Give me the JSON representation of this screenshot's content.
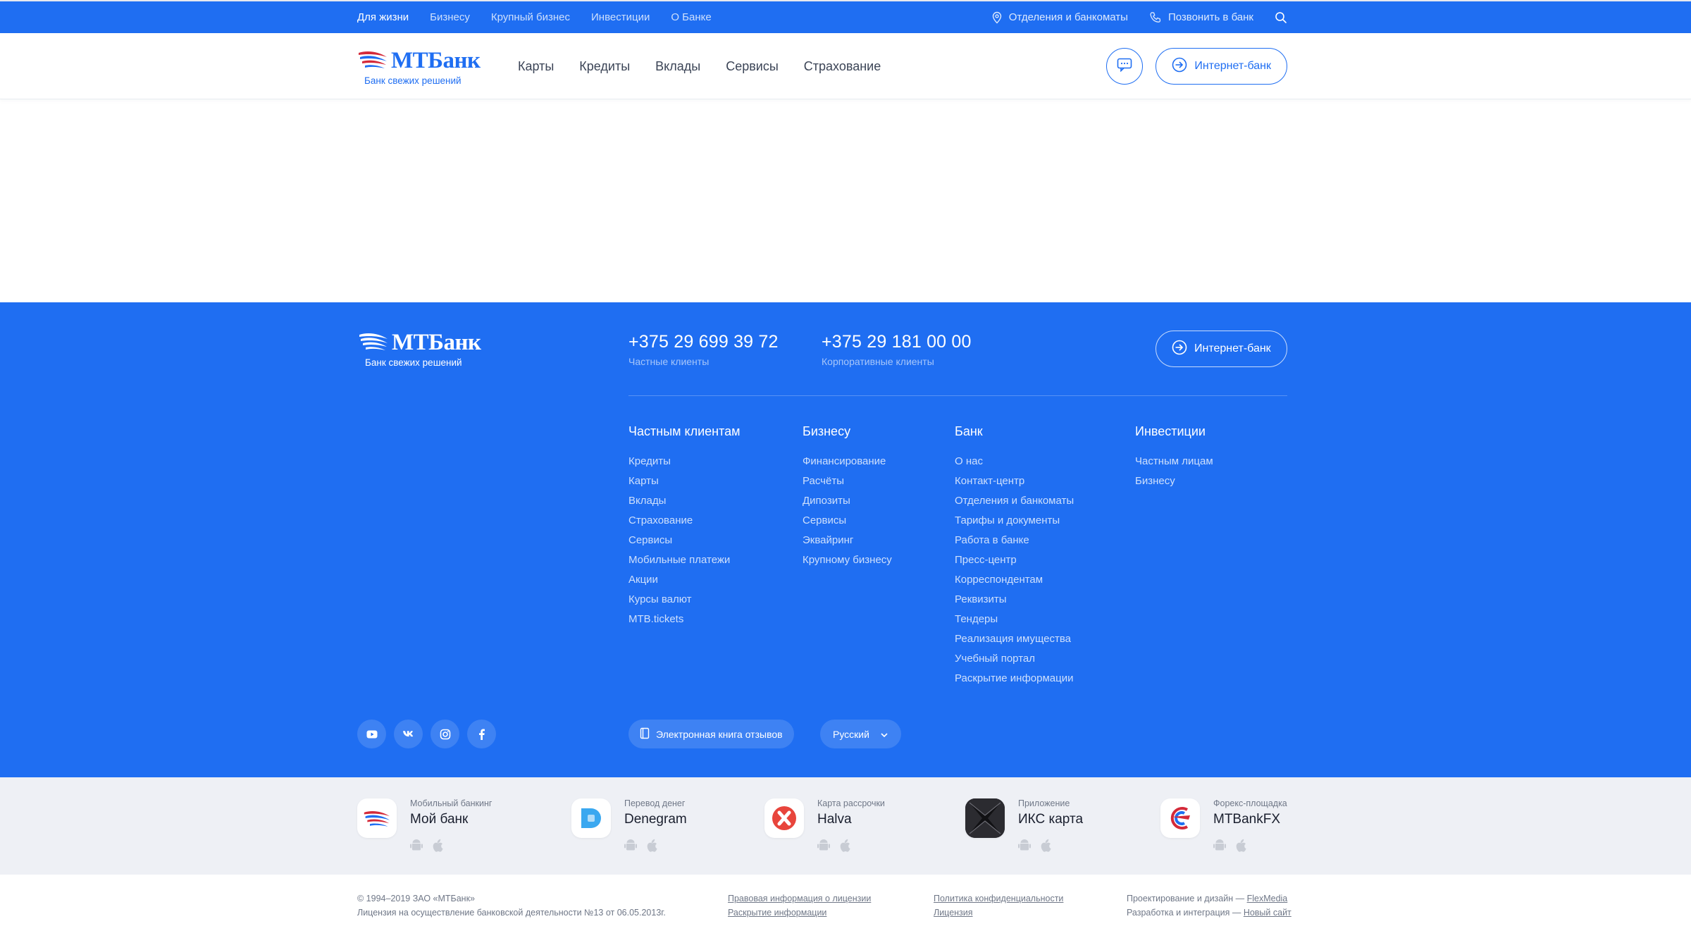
{
  "topbar": {
    "nav": [
      "Для жизни",
      "Бизнесу",
      "Крупный бизнес",
      "Инвестиции",
      "О Банке"
    ],
    "branches": "Отделения и банкоматы",
    "call": "Позвонить в банк"
  },
  "brand": {
    "name": "МТБанк",
    "tagline": "Банк свежих решений"
  },
  "header": {
    "nav": [
      "Карты",
      "Кредиты",
      "Вклады",
      "Сервисы",
      "Страхование"
    ],
    "internet_bank": "Интернет-банк"
  },
  "footer": {
    "phones": [
      {
        "number": "+375 29 699 39 72",
        "label": "Частные клиенты"
      },
      {
        "number": "+375 29 181 00 00",
        "label": "Корпоративные клиенты"
      }
    ],
    "internet_bank": "Интернет-банк",
    "columns": [
      {
        "title": "Частным клиентам",
        "items": [
          "Кредиты",
          "Карты",
          "Вклады",
          "Страхование",
          "Сервисы",
          "Мобильные платежи",
          "Акции",
          "Курсы валют",
          "MTB.tickets"
        ]
      },
      {
        "title": "Бизнесу",
        "items": [
          "Финансирование",
          "Расчёты",
          "Дипозиты",
          "Сервисы",
          "Эквайринг",
          "Крупному бизнесу"
        ]
      },
      {
        "title": "Банк",
        "items": [
          "О нас",
          "Контакт-центр",
          "Отделения и банкоматы",
          "Тарифы и документы",
          "Работа в банке",
          "Пресс-центр",
          "Корреспондентам",
          "Реквизиты",
          "Тендеры",
          "Реализация имущества",
          "Учебный портал",
          "Раскрытие информации"
        ]
      },
      {
        "title": "Инвестиции",
        "items": [
          "Частным лицам",
          "Бизнесу"
        ]
      }
    ],
    "socials": [
      "youtube-icon",
      "vk-icon",
      "instagram-icon",
      "facebook-icon"
    ],
    "review_book": "Электронная книга отзывов",
    "language": "Русский"
  },
  "apps": [
    {
      "caption": "Мобильный банкинг",
      "name": "Мой банк"
    },
    {
      "caption": "Перевод денег",
      "name": "Denegram"
    },
    {
      "caption": "Карта рассрочки",
      "name": "Halva"
    },
    {
      "caption": "Приложение",
      "name": "ИКС карта"
    },
    {
      "caption": "Форекс-площадка",
      "name": "MTBankFX"
    }
  ],
  "legal": {
    "copyright": "© 1994–2019 ЗАО «МТБанк»",
    "license": "Лицензия на осуществление банковской деятельности №13 от 06.05.2013г.",
    "links1": [
      "Правовая информация о лицензии",
      "Раскрытие информации"
    ],
    "links2": [
      "Политика конфиденциальности",
      "Лицензия"
    ],
    "design_label": "Проектирование и дизайн —",
    "design_link": "FlexMedia",
    "dev_label": "Разработка и интеграция —",
    "dev_link": "Новый сайт"
  },
  "colors": {
    "brand": "#1f6ef2",
    "apps_bg": "#eef0f5"
  }
}
